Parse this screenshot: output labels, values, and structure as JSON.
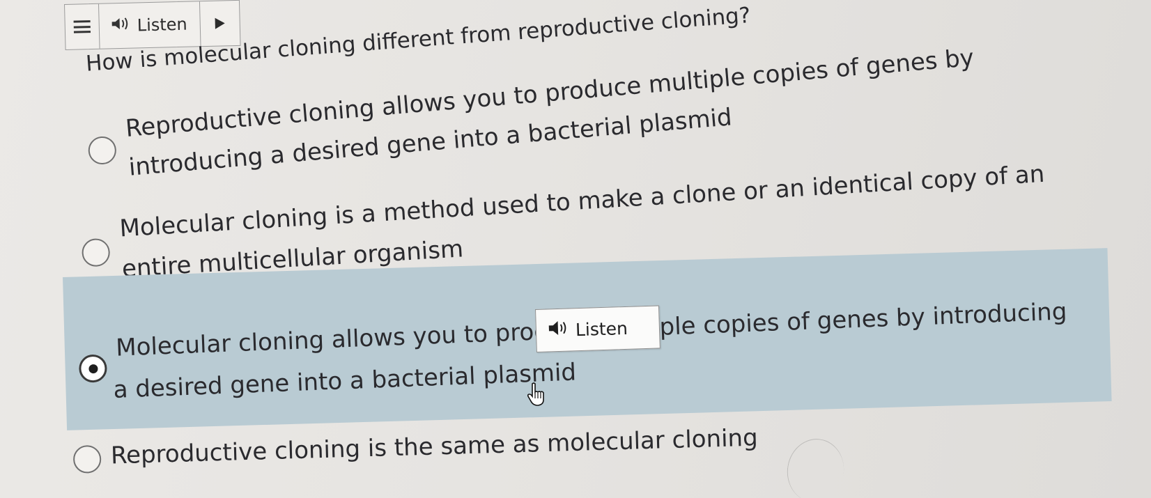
{
  "toolbar": {
    "menu_icon": "hamburger-menu-icon",
    "listen_label": "Listen",
    "speaker_icon": "speaker-icon",
    "play_icon": "play-icon"
  },
  "question": {
    "text": "How is molecular cloning different from reproductive cloning?"
  },
  "options": [
    {
      "line1": "Reproductive cloning allows you to produce multiple copies of genes by",
      "line2": "introducing a desired gene into a bacterial plasmid",
      "selected": false
    },
    {
      "line1": "Molecular cloning is a method used to make a clone or an identical copy of an",
      "line2": "entire multicellular organism",
      "selected": false
    },
    {
      "line1": "Molecular cloning allows you to produce multiple copies of genes by introducing",
      "line2": "a desired gene into a bacterial plasmid",
      "selected": true
    },
    {
      "line1": "Reproductive cloning is the same as molecular cloning",
      "line2": "",
      "selected": false
    }
  ],
  "popup": {
    "listen_label": "Listen"
  },
  "colors": {
    "selected_highlight": "#b9cbd3",
    "background": "#e9e7e4"
  }
}
